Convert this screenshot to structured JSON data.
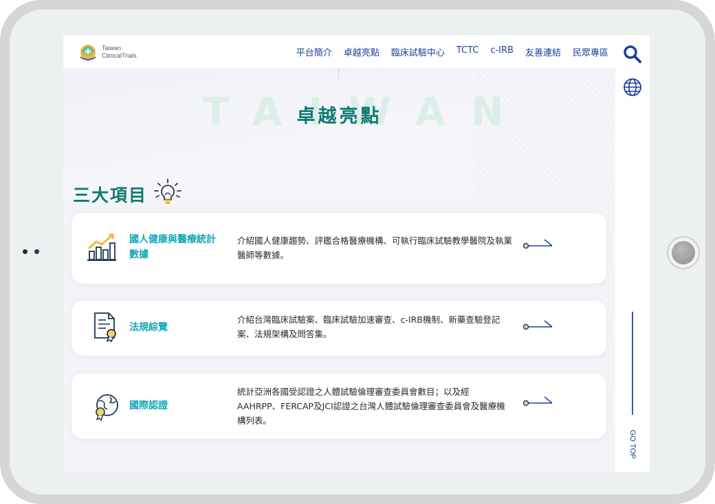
{
  "logo": {
    "line1": "Taiwan",
    "line2": "ClinicalTrials"
  },
  "nav": {
    "items": [
      {
        "label": "平台簡介"
      },
      {
        "label": "卓越亮點"
      },
      {
        "label": "臨床試驗中心"
      },
      {
        "label": "TCTC"
      },
      {
        "label": "c-IRB"
      },
      {
        "label": "友善連結"
      },
      {
        "label": "民眾專區"
      }
    ]
  },
  "hero": {
    "watermark": "TAIWAN",
    "title": "卓越亮點"
  },
  "section": {
    "title": "三大項目"
  },
  "cards": [
    {
      "title": "國人健康與醫療統計數據",
      "description": "介紹國人健康趨勢、評鑑合格醫療機構、可執行臨床試驗教學醫院及執業醫師等數據。"
    },
    {
      "title": "法規綜覽",
      "description": "介紹台灣臨床試驗案、臨床試驗加速審查、c-IRB機制、新藥查驗登記案、法規架構及問答集。"
    },
    {
      "title": "國際認證",
      "description": "統計亞洲各國受認證之人體試驗倫理審查委員會數目；以及經AAHRPP、FERCAP及JCI認證之台灣人體試驗倫理審查委員會及醫療機構列表。"
    }
  ],
  "sidebar": {
    "gotop_label": "GO TOP"
  },
  "colors": {
    "accent": "#0f7a73",
    "link": "#1d3f9a",
    "card_title": "#12a6b8",
    "watermark": "#dceee8"
  }
}
